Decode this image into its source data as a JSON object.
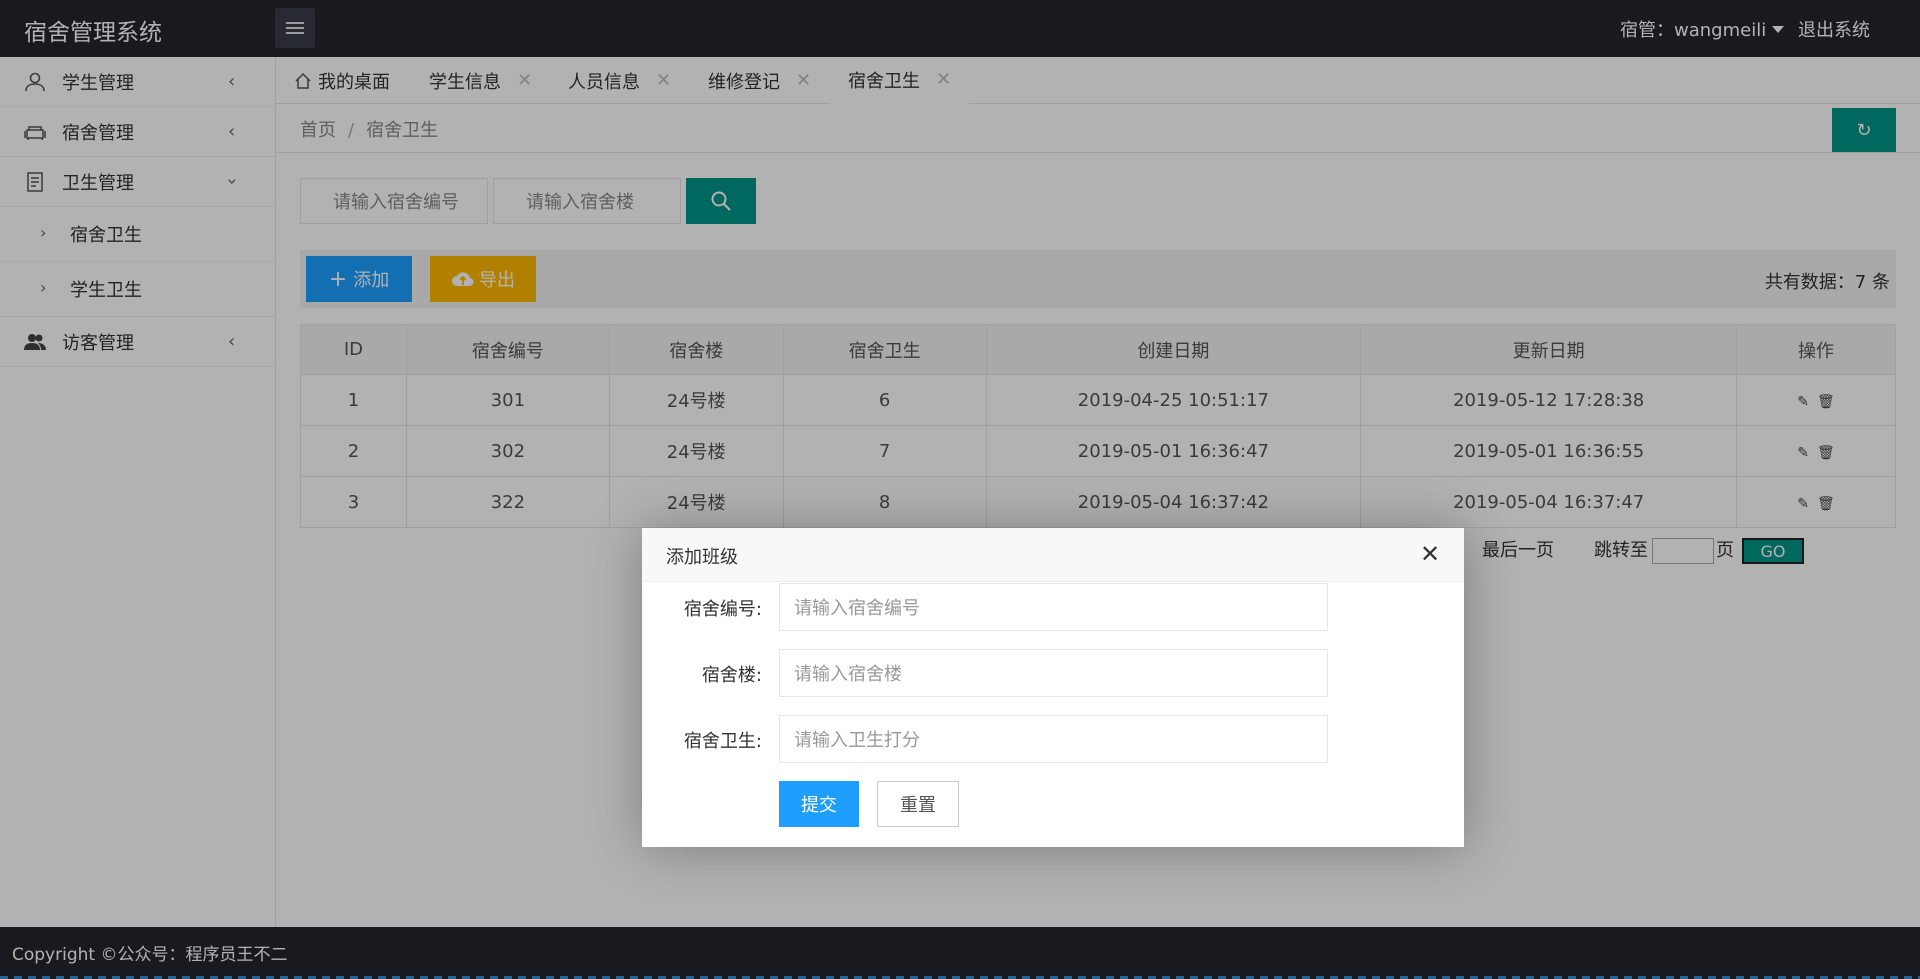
{
  "app": {
    "title": "宿舍管理系统"
  },
  "header": {
    "user_label": "宿管：wangmeili",
    "logout_label": "退出系统"
  },
  "sidebar": {
    "items": [
      {
        "label": "学生管理",
        "icon": "user-icon"
      },
      {
        "label": "宿舍管理",
        "icon": "sofa-icon"
      },
      {
        "label": "卫生管理",
        "icon": "document-icon"
      },
      {
        "label": "访客管理",
        "icon": "users-icon"
      }
    ],
    "sub_items": [
      {
        "label": "宿舍卫生"
      },
      {
        "label": "学生卫生"
      }
    ]
  },
  "tabs": [
    {
      "label": "我的桌面"
    },
    {
      "label": "学生信息"
    },
    {
      "label": "人员信息"
    },
    {
      "label": "维修登记"
    },
    {
      "label": "宿舍卫生"
    }
  ],
  "breadcrumb": {
    "home": "首页",
    "sep": "/",
    "current": "宿舍卫生"
  },
  "search": {
    "dorm_no_placeholder": "请输入宿舍编号",
    "building_placeholder": "请输入宿舍楼"
  },
  "toolbar": {
    "add_label": "添加",
    "export_label": "导出",
    "total_text": "共有数据：7 条"
  },
  "table": {
    "headers": [
      "ID",
      "宿舍编号",
      "宿舍楼",
      "宿舍卫生",
      "创建日期",
      "更新日期",
      "操作"
    ],
    "rows": [
      [
        "1",
        "301",
        "24号楼",
        "6",
        "2019-04-25 10:51:17",
        "2019-05-12 17:28:38"
      ],
      [
        "2",
        "302",
        "24号楼",
        "7",
        "2019-05-01 16:36:47",
        "2019-05-01 16:36:55"
      ],
      [
        "3",
        "322",
        "24号楼",
        "8",
        "2019-05-04 16:37:42",
        "2019-05-04 16:37:47"
      ]
    ]
  },
  "pager": {
    "last_label": "最后一页",
    "jump_label": "跳转至",
    "page_label": "页",
    "go_label": "GO"
  },
  "modal": {
    "title": "添加班级",
    "fields": [
      {
        "label": "宿舍编号:",
        "placeholder": "请输入宿舍编号"
      },
      {
        "label": "宿舍楼:",
        "placeholder": "请输入宿舍楼"
      },
      {
        "label": "宿舍卫生:",
        "placeholder": "请输入卫生打分"
      }
    ],
    "submit_label": "提交",
    "reset_label": "重置"
  },
  "footer": {
    "copyright": "Copyright ©公众号：程序员王不二"
  },
  "colors": {
    "header_bg": "#23262e",
    "accent_teal": "#009688",
    "accent_blue": "#1e9fff",
    "accent_yellow": "#ffb800"
  }
}
